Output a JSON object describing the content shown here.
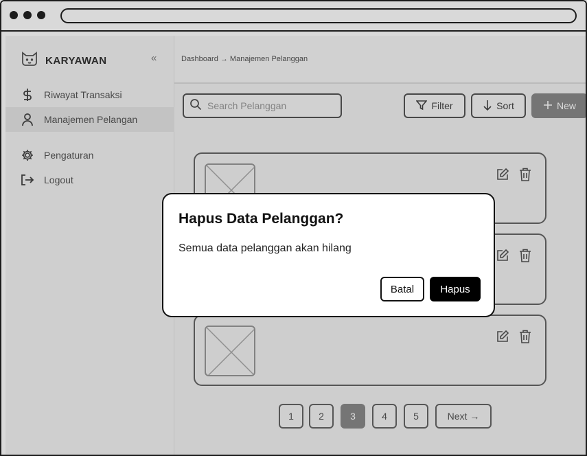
{
  "colors": {
    "primary": "#000000",
    "muted_button": "#8a8a8a",
    "backdrop": "#f2f2f2"
  },
  "sidebar": {
    "brand": "KARYAWAN",
    "brand_icon": "cat-face-icon",
    "collapse_icon": "chevrons-left-icon",
    "collapse_glyph": "«",
    "items": [
      {
        "label": "Riwayat Transaksi",
        "icon": "dollar-icon",
        "active": false
      },
      {
        "label": "Manajemen Pelangan",
        "icon": "user-icon",
        "active": true
      },
      {
        "label": "Pengaturan",
        "icon": "gear-icon",
        "active": false
      },
      {
        "label": "Logout",
        "icon": "logout-icon",
        "active": false
      }
    ]
  },
  "breadcrumb": {
    "text": "Dashboard → Manajemen Pelanggan"
  },
  "toolbar": {
    "search_placeholder": "Search Pelanggan",
    "filter_label": "Filter",
    "sort_label": "Sort",
    "new_label": "New"
  },
  "pagination": {
    "pages": [
      "1",
      "2",
      "3",
      "4",
      "5"
    ],
    "current": "3",
    "next_label": "Next →"
  },
  "modal": {
    "title": "Hapus Data Pelanggan?",
    "message": "Semua data pelanggan akan hilang",
    "cancel_label": "Batal",
    "confirm_label": "Hapus"
  }
}
